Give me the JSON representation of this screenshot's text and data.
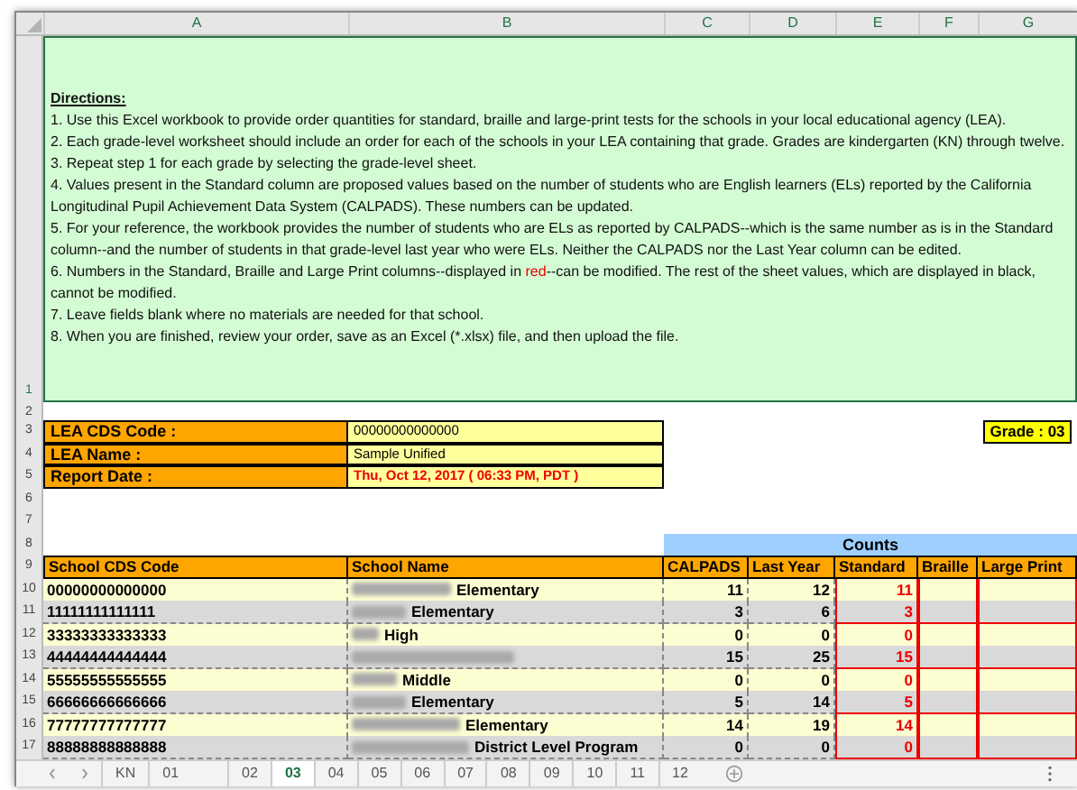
{
  "column_headers": [
    "A",
    "B",
    "C",
    "D",
    "E",
    "F",
    "G"
  ],
  "row_numbers": [
    "1",
    "2",
    "3",
    "4",
    "5",
    "6",
    "7",
    "8",
    "9",
    "10",
    "11",
    "12",
    "13",
    "14",
    "15",
    "16",
    "17"
  ],
  "directions": {
    "heading": "Directions:",
    "items": [
      [
        {
          "text": "1. Use this Excel workbook to provide order quantities for standard, braille and large-print tests for the schools in your local educational agency (LEA).",
          "kind": "plain"
        }
      ],
      [
        {
          "text": "2. Each grade-level worksheet should include an order for each of the schools in your LEA containing that grade. Grades are kindergarten (KN) through twelve.",
          "kind": "plain"
        }
      ],
      [
        {
          "text": "3. Repeat step 1 for each grade by selecting the grade-level sheet.",
          "kind": "plain"
        }
      ],
      [
        {
          "text": "4. Values present in the Standard column are proposed values based on the number of students who are English learners (ELs) reported by the California Longitudinal Pupil Achievement Data System (CALPADS). These numbers can be updated.",
          "kind": "plain"
        }
      ],
      [
        {
          "text": "5. For your reference, the workbook provides the number of students who are ELs as reported by CALPADS--which is the same number as is in the Standard column--and the number of students in that grade-level last year who were ELs. Neither the CALPADS nor the Last Year column can be edited.",
          "kind": "plain"
        }
      ],
      [
        {
          "text": "6. Numbers in the Standard, Braille and Large Print columns--displayed in ",
          "kind": "plain"
        },
        {
          "text": "red",
          "kind": "highlight"
        },
        {
          "text": "--can be modified. The rest of the sheet values, which are displayed in black, cannot be modified.",
          "kind": "plain"
        }
      ],
      [
        {
          "text": "7. Leave fields blank where no materials are needed for that school.",
          "kind": "plain"
        }
      ],
      [
        {
          "text": "8. When you are finished, review your order, save as an Excel (*.xlsx) file, and then upload the file.",
          "kind": "plain"
        }
      ]
    ]
  },
  "lea_info": [
    {
      "label": "LEA CDS Code :",
      "value": "00000000000000",
      "highlight": false
    },
    {
      "label": "LEA Name :",
      "value": "Sample Unified",
      "highlight": false
    },
    {
      "label": "Report Date :",
      "value": "Thu, Oct 12, 2017 ( 06:33 PM, PDT )",
      "highlight": true
    }
  ],
  "grade": "Grade : 03",
  "counts_header": "Counts",
  "table": {
    "columns": [
      "School CDS Code",
      "School Name",
      "CALPADS",
      "Last Year",
      "Standard",
      "Braille",
      "Large Print"
    ],
    "rows": [
      {
        "code": "00000000000000",
        "name": "Elementary",
        "calpads": "11",
        "last_year": "12",
        "standard": "11"
      },
      {
        "code": "11111111111111",
        "name": "Elementary",
        "calpads": "3",
        "last_year": "6",
        "standard": "3"
      },
      {
        "code": "33333333333333",
        "name": "High",
        "calpads": "0",
        "last_year": "0",
        "standard": "0"
      },
      {
        "code": "44444444444444",
        "calpads": "15",
        "last_year": "25",
        "standard": "15"
      },
      {
        "code": "55555555555555",
        "name": "Middle",
        "calpads": "0",
        "last_year": "0",
        "standard": "0"
      },
      {
        "code": "66666666666666",
        "name": "Elementary",
        "calpads": "5",
        "last_year": "14",
        "standard": "5"
      },
      {
        "code": "77777777777777",
        "name": "Elementary",
        "calpads": "14",
        "last_year": "19",
        "standard": "14"
      },
      {
        "code": "88888888888888",
        "name": "District Level Program",
        "calpads": "0",
        "last_year": "0",
        "standard": "0"
      }
    ]
  },
  "sheet_tabs": [
    {
      "label": "KN",
      "selected": false
    },
    {
      "label": "01",
      "selected": false
    },
    {
      "label": "02",
      "selected": false
    },
    {
      "label": "03",
      "selected": true
    },
    {
      "label": "04",
      "selected": false
    },
    {
      "label": "05",
      "selected": false
    },
    {
      "label": "06",
      "selected": false
    },
    {
      "label": "07",
      "selected": false
    },
    {
      "label": "08",
      "selected": false
    },
    {
      "label": "09",
      "selected": false
    },
    {
      "label": "10",
      "selected": false
    },
    {
      "label": "11",
      "selected": false
    },
    {
      "label": "12",
      "selected": false
    }
  ]
}
